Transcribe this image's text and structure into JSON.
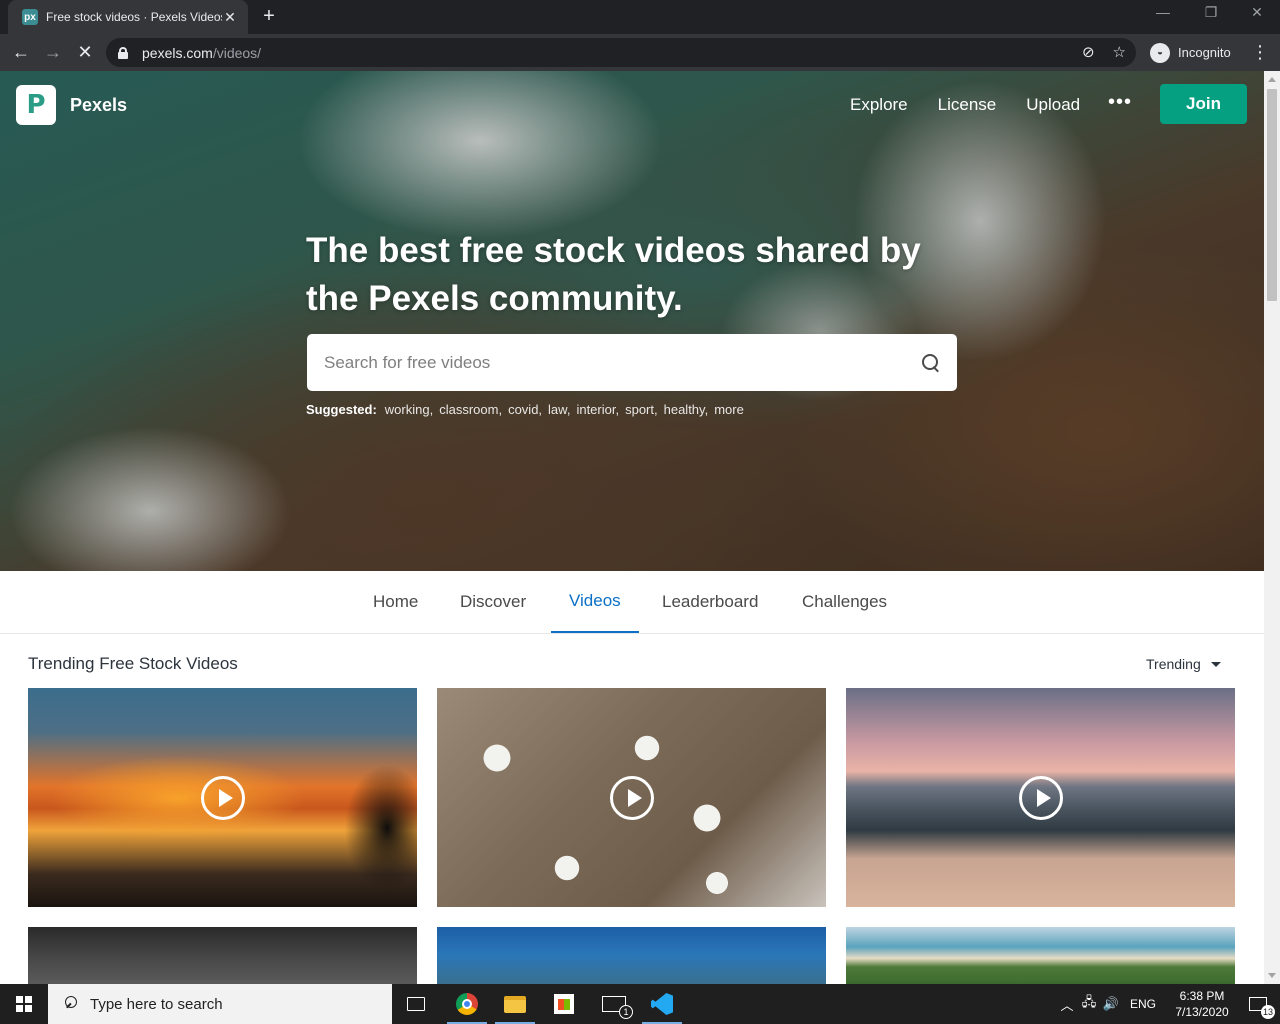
{
  "browser": {
    "tab_title": "Free stock videos · Pexels Videos",
    "tab_favicon": "px",
    "tab_close": "✕",
    "new_tab": "+",
    "window_controls": {
      "minimize": "—",
      "maximize": "❐",
      "close": "✕"
    },
    "back": "←",
    "forward": "→",
    "reload_stop": "✕",
    "url_host": "pexels.com",
    "url_path": "/videos/",
    "eye_off_icon": "⊘",
    "bookmark_star": "☆",
    "profile_label": "Incognito",
    "profile_glyph": "◒",
    "menu": "⋮"
  },
  "site": {
    "brand": "Pexels",
    "logo_glyph": "P",
    "nav": [
      "Explore",
      "License",
      "Upload"
    ],
    "more": "•••",
    "join_label": "Join",
    "join_color": "#05a081"
  },
  "hero": {
    "title": "The best free stock videos shared by the Pexels community.",
    "search_placeholder": "Search for free videos",
    "suggested_label": "Suggested:",
    "suggested_tags": [
      "working,",
      "classroom,",
      "covid,",
      "law,",
      "interior,",
      "sport,",
      "healthy,",
      "more"
    ]
  },
  "subnav": {
    "items": [
      "Home",
      "Discover",
      "Videos",
      "Leaderboard",
      "Challenges"
    ],
    "active": "Videos",
    "active_color": "#0b70c6"
  },
  "content": {
    "section_title": "Trending Free Stock Videos",
    "sort_label": "Trending"
  },
  "taskbar": {
    "search_placeholder": "Type here to search",
    "mail_badge": "1",
    "language": "ENG",
    "time": "6:38 PM",
    "date": "7/13/2020",
    "notification_count": "13",
    "tray_chevron": "︿",
    "network_icon": "🖧",
    "volume_icon": "🔊"
  }
}
